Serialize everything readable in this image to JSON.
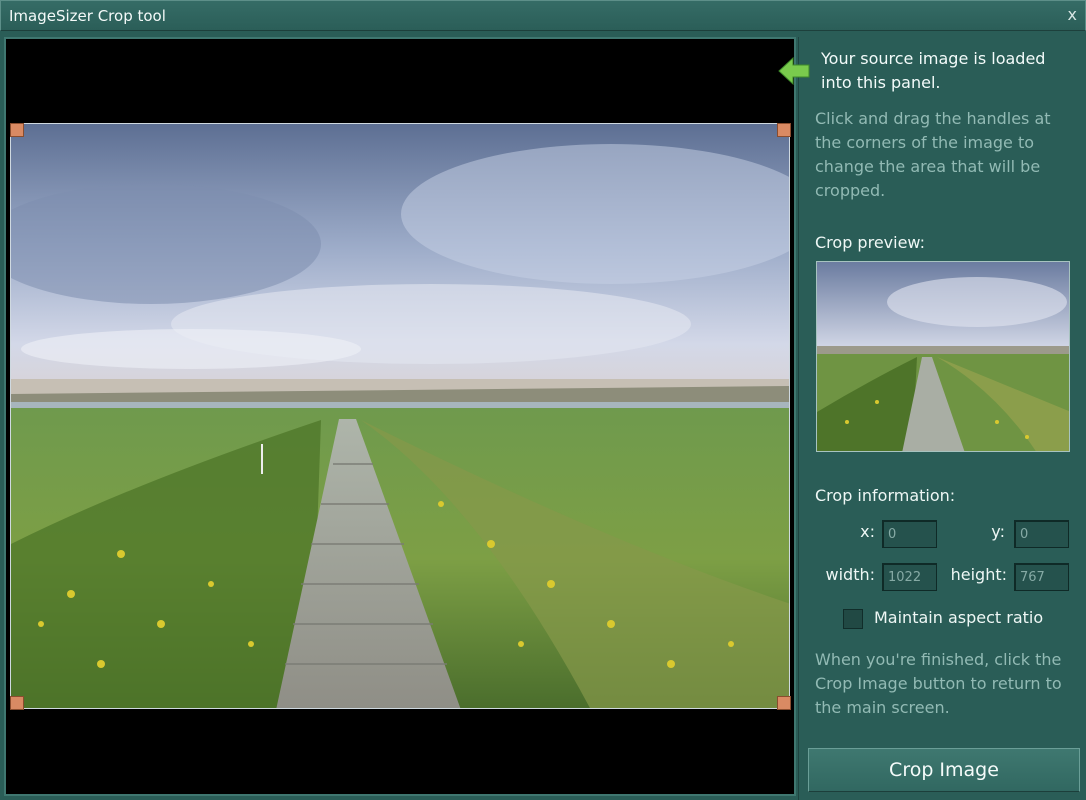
{
  "window": {
    "title": "ImageSizer Crop tool",
    "close_label": "x"
  },
  "panel": {
    "intro": "Your source image is loaded into this panel.",
    "help": "Click and drag the handles at the corners of the image to change the area that will be cropped.",
    "preview_label": "Crop preview:",
    "info_label": "Crop information:",
    "fields": {
      "x_label": "x:",
      "x_value": "0",
      "y_label": "y:",
      "y_value": "0",
      "width_label": "width:",
      "width_value": "1022",
      "height_label": "height:",
      "height_value": "767"
    },
    "aspect_label": "Maintain aspect ratio",
    "aspect_checked": false,
    "finish_text": "When you're finished, click the Crop Image button to return to the main screen.",
    "crop_button": "Crop Image"
  },
  "icons": {
    "arrow": "left-arrow-icon",
    "close": "close-icon"
  },
  "colors": {
    "window_bg": "#2a5d57",
    "handle": "#d98a63",
    "accent_arrow": "#7acb4d"
  }
}
